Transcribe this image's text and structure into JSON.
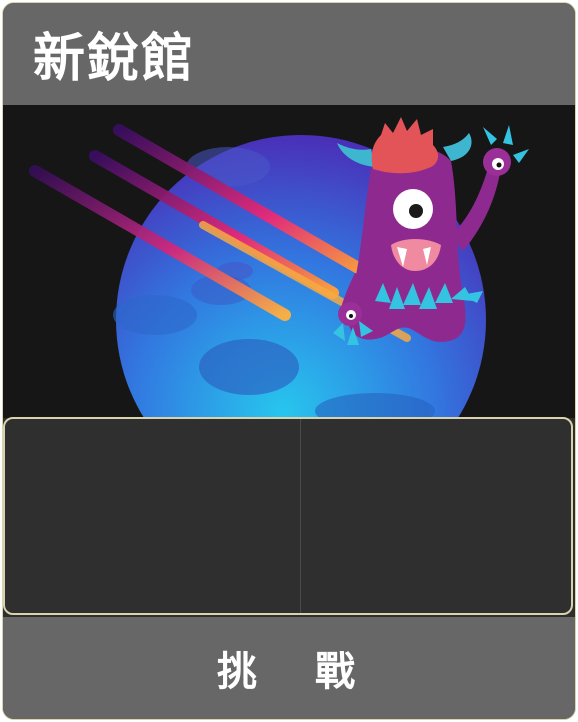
{
  "card": {
    "title": "新銳館",
    "action_label": "挑 戰"
  },
  "artwork": {
    "subject": "one-eyed-purple-monster-over-blue-planet",
    "colors": {
      "background": "#161616",
      "planet": "#2f8ff0",
      "monster": "#8e2a8f",
      "hair": "#e25457",
      "horns": "#3fb6d0",
      "leaves": "#34c3e0"
    }
  }
}
